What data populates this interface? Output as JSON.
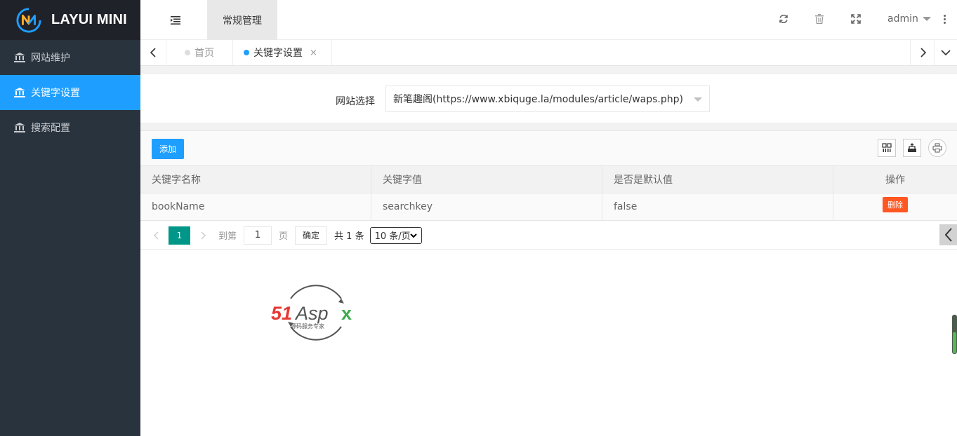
{
  "app": {
    "logo_text": "LAYUI MINI"
  },
  "sidebar": {
    "items": [
      {
        "label": "网站维护",
        "active": false
      },
      {
        "label": "关键字设置",
        "active": true
      },
      {
        "label": "搜索配置",
        "active": false
      }
    ]
  },
  "header": {
    "top_tab": "常规管理",
    "user": "admin",
    "icons": [
      "refresh-icon",
      "trash-icon",
      "fullscreen-icon",
      "more-icon"
    ]
  },
  "tabs": [
    {
      "label": "首页",
      "active": false
    },
    {
      "label": "关键字设置",
      "active": true,
      "close": "×"
    }
  ],
  "filter": {
    "label": "网站选择",
    "selected": "新笔趣阁(https://www.xbiquge.la/modules/article/waps.php)"
  },
  "toolbar": {
    "add_label": "添加",
    "tools": [
      "columns-icon",
      "export-icon",
      "print-icon"
    ]
  },
  "table": {
    "columns": [
      "关键字名称",
      "关键字值",
      "是否是默认值",
      "操作"
    ],
    "rows": [
      {
        "name": "bookName",
        "value": "searchkey",
        "is_default": "false",
        "action": "删除"
      }
    ]
  },
  "pager": {
    "current": "1",
    "goto_prefix": "到第",
    "goto_value": "1",
    "goto_suffix": "页",
    "ok_label": "确定",
    "total_text": "共 1 条",
    "limit": "10 条/页"
  },
  "watermark": {
    "brand": "51Aspx",
    "tagline": "源码服务专家"
  },
  "colors": {
    "sidebar_bg": "#28333e",
    "logo_bg": "#20222a",
    "active_blue": "#1e9fff",
    "page_green": "#009688",
    "danger": "#ff5722"
  }
}
